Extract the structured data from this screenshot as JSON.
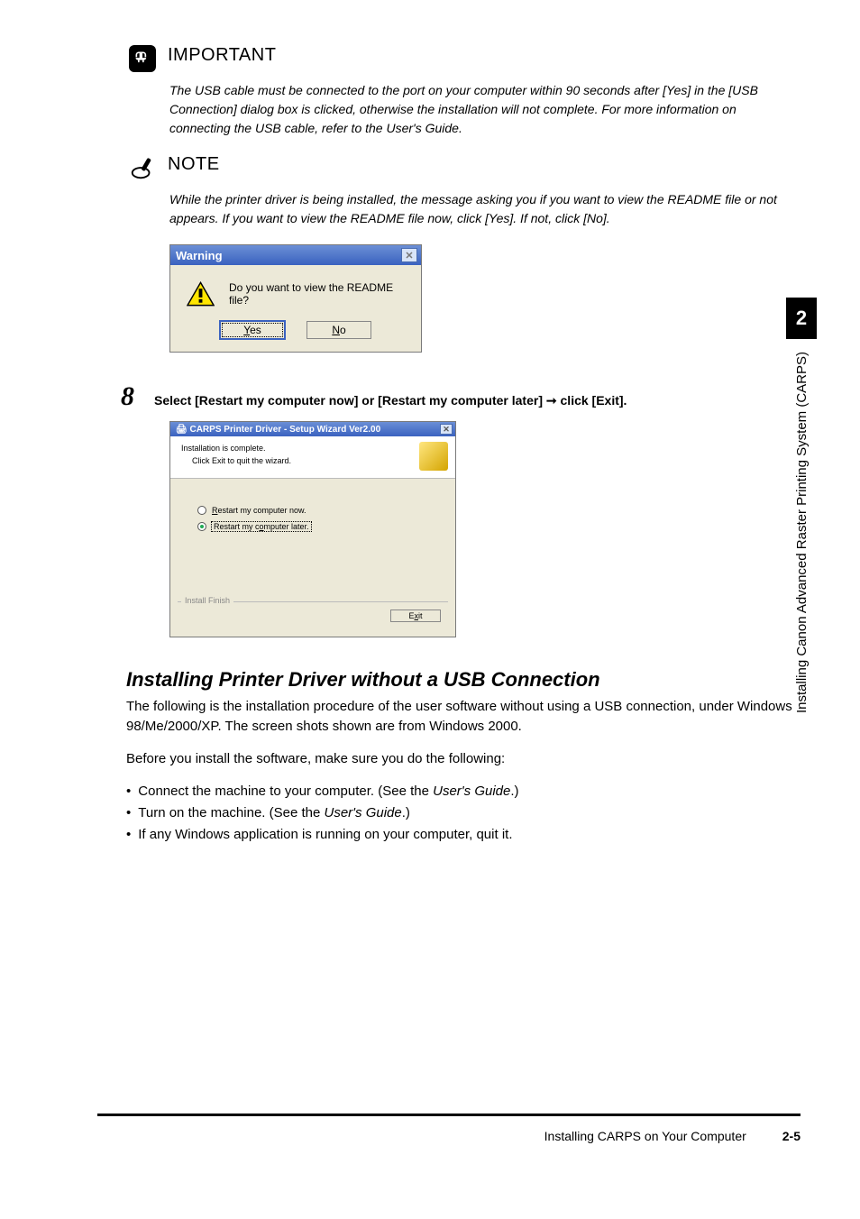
{
  "important": {
    "title": "IMPORTANT",
    "body": "The USB cable must be connected to the port on your computer within 90 seconds after [Yes] in the [USB Connection] dialog box is clicked, otherwise the installation will not complete. For more information on connecting the USB cable, refer to the User's Guide."
  },
  "note": {
    "title": "NOTE",
    "body": "While the printer driver is being installed, the message asking you if you want to view the README file or not appears. If you want to view the README file now, click [Yes]. If not, click [No]."
  },
  "warning_dialog": {
    "title": "Warning",
    "message": "Do you want to view the README file?",
    "yes": "Yes",
    "no": "No"
  },
  "step8": {
    "num": "8",
    "text_pre": "Select [Restart my computer now] or [Restart my computer later] ",
    "text_post": " click [Exit]."
  },
  "wizard": {
    "title": "CARPS Printer Driver - Setup Wizard Ver2.00",
    "line1": "Installation is complete.",
    "line2": "Click Exit to quit the wizard.",
    "opt_now": "Restart my computer now.",
    "opt_later": "Restart my computer later.",
    "group": "Install Finish",
    "exit": "Exit"
  },
  "section": {
    "heading": "Installing Printer Driver without a USB Connection",
    "p1": "The following is the installation procedure of the user software without using a USB connection, under Windows 98/Me/2000/XP.  The screen shots shown are from Windows 2000.",
    "p2": "Before you install the software, make sure you do the following:",
    "b1_pre": "Connect the machine to your computer. (See the ",
    "b1_ital": "User's Guide",
    "b1_post": ".)",
    "b2_pre": "Turn on the machine. (See the ",
    "b2_ital": "User's Guide",
    "b2_post": ".)",
    "b3": "If any Windows application is running on your computer, quit it."
  },
  "sidetab": {
    "num": "2",
    "text": "Installing Canon Advanced Raster Printing System (CARPS)"
  },
  "footer": {
    "title": "Installing CARPS on Your Computer",
    "page": "2-5"
  }
}
